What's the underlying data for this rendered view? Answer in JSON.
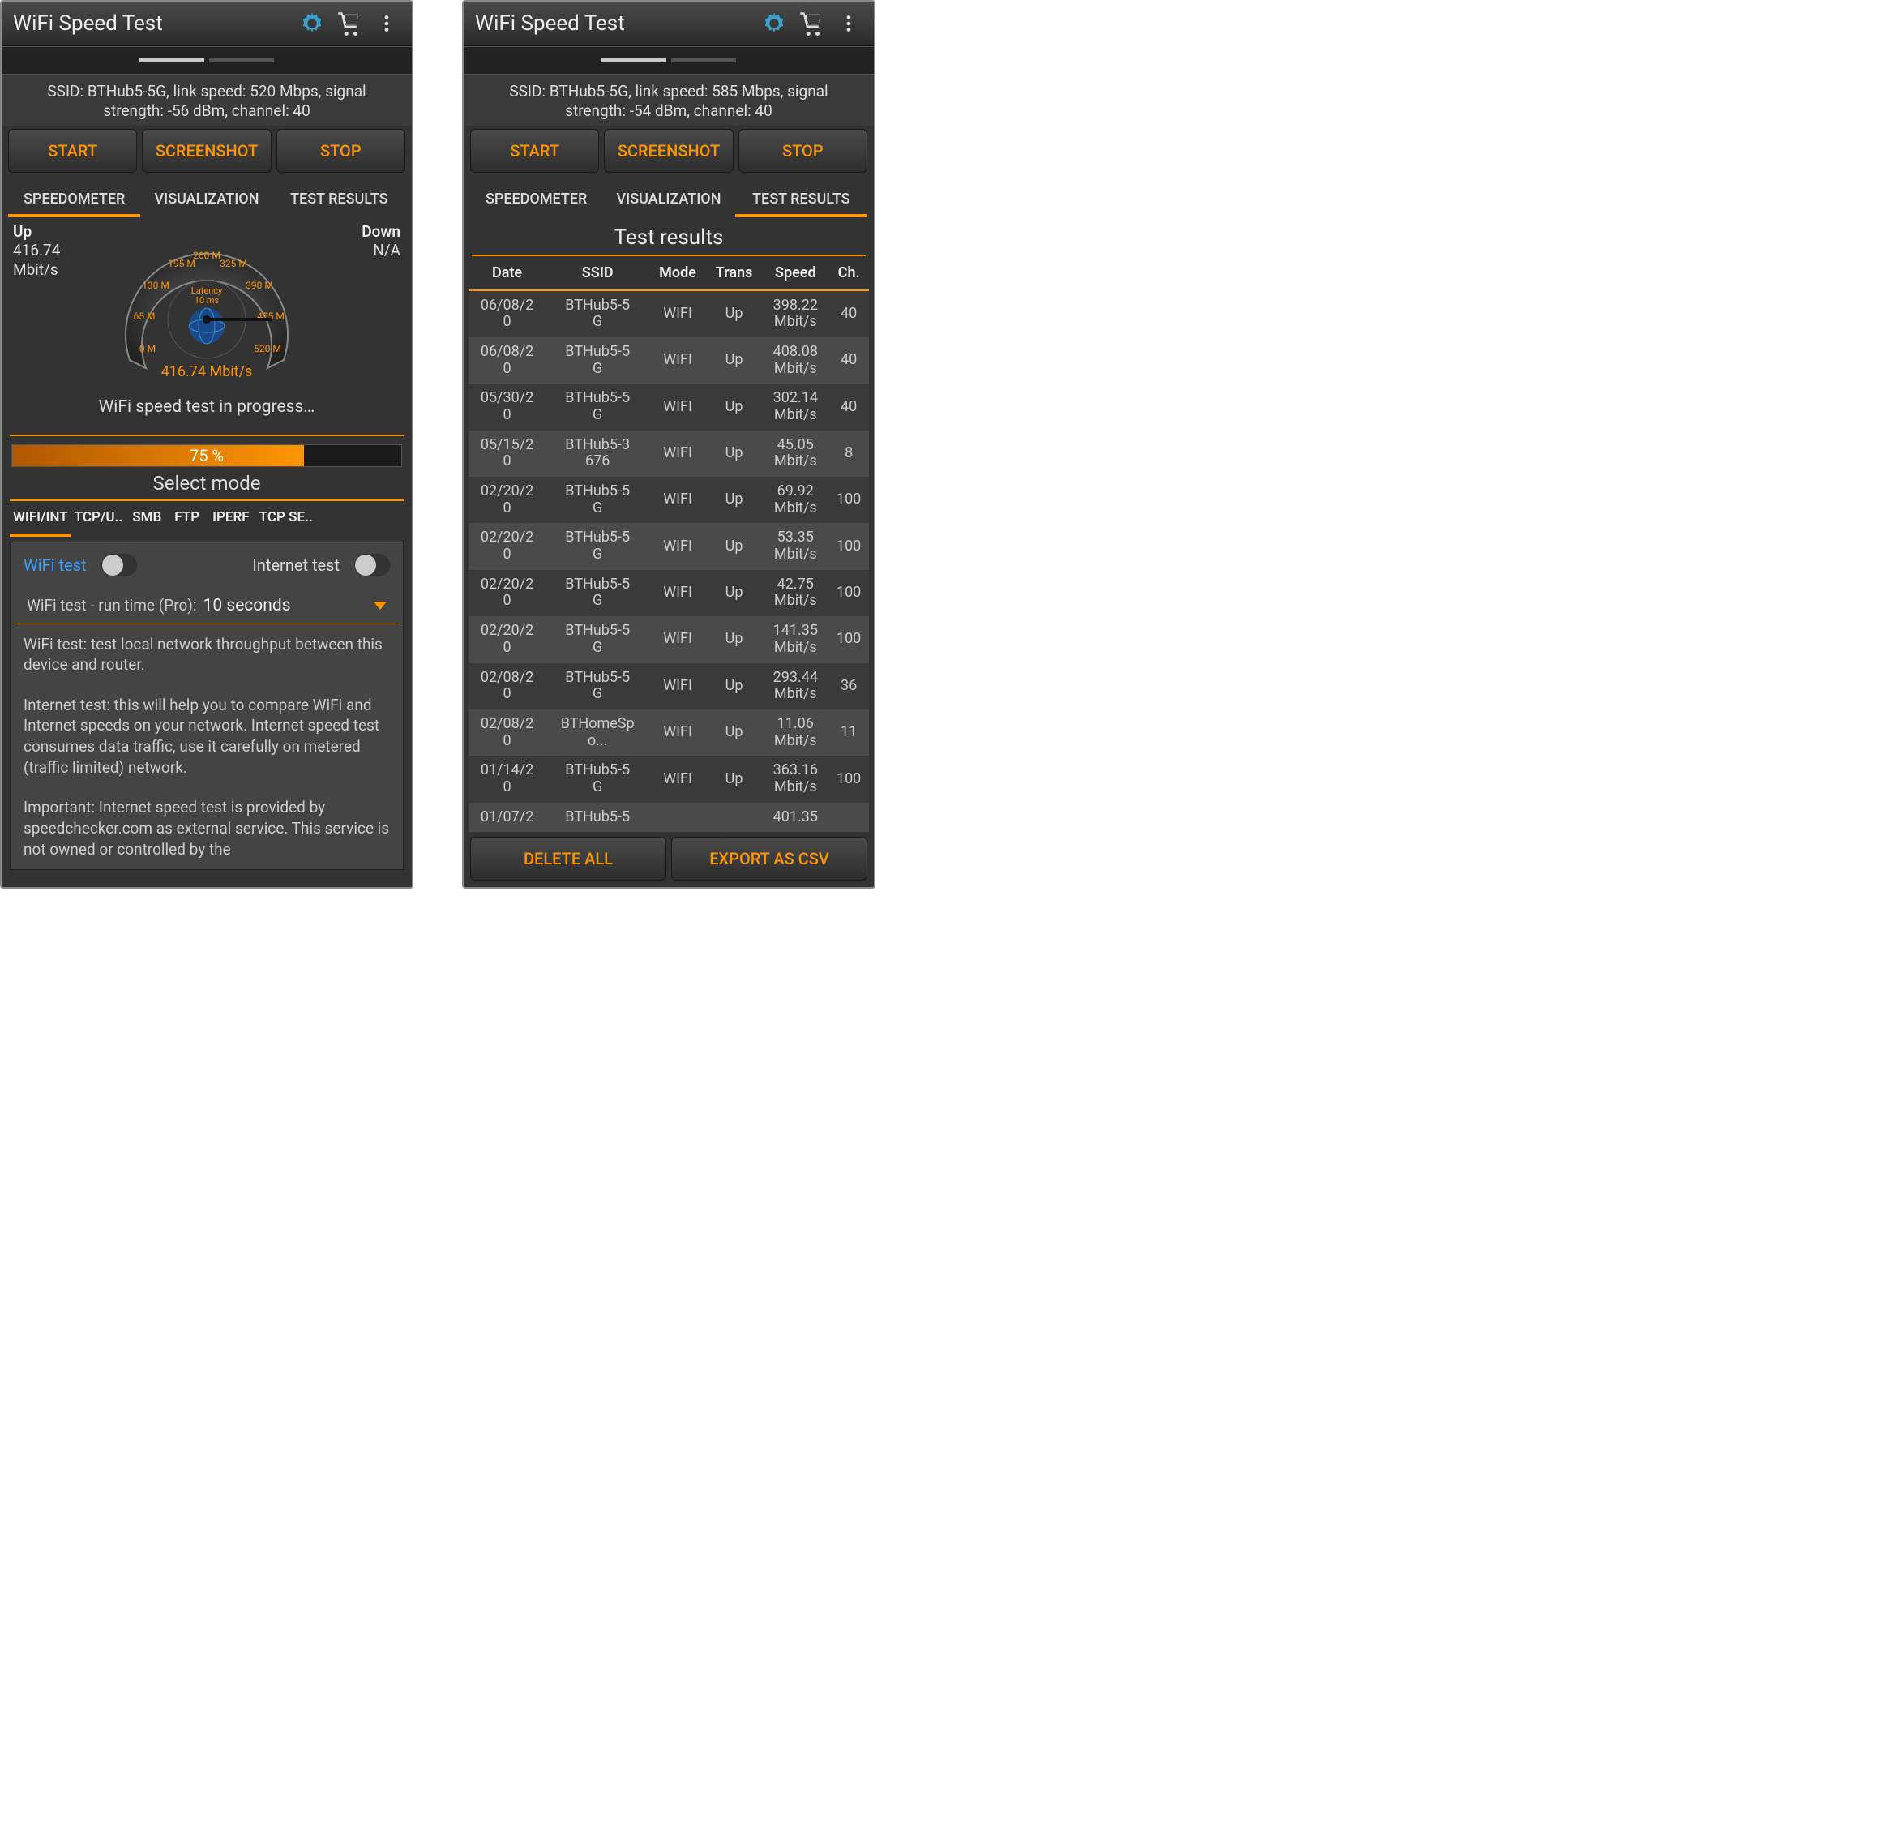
{
  "app_title": "WiFi Speed Test",
  "left": {
    "info": "SSID: BTHub5-5G, link speed: 520 Mbps, signal strength: -56 dBm, channel: 40",
    "buttons": {
      "start": "START",
      "screenshot": "SCREENSHOT",
      "stop": "STOP"
    },
    "tabs": [
      "SPEEDOMETER",
      "VISUALIZATION",
      "TEST RESULTS"
    ],
    "active_tab": 0,
    "up_label": "Up",
    "up_value": "416.74 Mbit/s",
    "down_label": "Down",
    "down_value": "N/A",
    "gauge": {
      "ticks": [
        "0 M",
        "65 M",
        "130 M",
        "195 M",
        "260 M",
        "325 M",
        "390 M",
        "455 M",
        "520 M"
      ],
      "latency_label": "Latency",
      "latency_value": "10 ms",
      "readout": "416.74 Mbit/s"
    },
    "status": "WiFi speed test in progress…",
    "progress_pct": "75 %",
    "select_mode": "Select mode",
    "mode_tabs": [
      "WIFI/INT",
      "TCP/U..",
      "SMB",
      "FTP",
      "IPERF",
      "TCP SE.."
    ],
    "active_mode": 0,
    "wifi_test_label": "WiFi test",
    "internet_test_label": "Internet test",
    "runtime_label": "WiFi test - run time (Pro):",
    "runtime_value": "10 seconds",
    "desc1": "WiFi test: test local network throughput between this device and router.",
    "desc2": " Internet test: this will help you to compare WiFi and Internet speeds on your network. Internet speed test consumes data traffic, use it carefully on metered (traffic limited) network.",
    "desc3": "Important: Internet speed test is provided by speedchecker.com as external service. This service is not owned or controlled by the"
  },
  "right": {
    "info": "SSID: BTHub5-5G, link speed: 585 Mbps, signal strength: -54 dBm, channel: 40",
    "buttons": {
      "start": "START",
      "screenshot": "SCREENSHOT",
      "stop": "STOP"
    },
    "tabs": [
      "SPEEDOMETER",
      "VISUALIZATION",
      "TEST RESULTS"
    ],
    "active_tab": 2,
    "heading": "Test results",
    "columns": [
      "Date",
      "SSID",
      "Mode",
      "Trans",
      "Speed",
      "Ch."
    ],
    "rows": [
      {
        "date": "06/08/20",
        "ssid": "BTHub5-5G",
        "mode": "WIFI",
        "trans": "Up",
        "speed": "398.22 Mbit/s",
        "ch": "40"
      },
      {
        "date": "06/08/20",
        "ssid": "BTHub5-5G",
        "mode": "WIFI",
        "trans": "Up",
        "speed": "408.08 Mbit/s",
        "ch": "40"
      },
      {
        "date": "05/30/20",
        "ssid": "BTHub5-5G",
        "mode": "WIFI",
        "trans": "Up",
        "speed": "302.14 Mbit/s",
        "ch": "40"
      },
      {
        "date": "05/15/20",
        "ssid": "BTHub5-3676",
        "mode": "WIFI",
        "trans": "Up",
        "speed": "45.05 Mbit/s",
        "ch": "8"
      },
      {
        "date": "02/20/20",
        "ssid": "BTHub5-5G",
        "mode": "WIFI",
        "trans": "Up",
        "speed": "69.92 Mbit/s",
        "ch": "100"
      },
      {
        "date": "02/20/20",
        "ssid": "BTHub5-5G",
        "mode": "WIFI",
        "trans": "Up",
        "speed": "53.35 Mbit/s",
        "ch": "100"
      },
      {
        "date": "02/20/20",
        "ssid": "BTHub5-5G",
        "mode": "WIFI",
        "trans": "Up",
        "speed": "42.75 Mbit/s",
        "ch": "100"
      },
      {
        "date": "02/20/20",
        "ssid": "BTHub5-5G",
        "mode": "WIFI",
        "trans": "Up",
        "speed": "141.35 Mbit/s",
        "ch": "100"
      },
      {
        "date": "02/08/20",
        "ssid": "BTHub5-5G",
        "mode": "WIFI",
        "trans": "Up",
        "speed": "293.44 Mbit/s",
        "ch": "36"
      },
      {
        "date": "02/08/20",
        "ssid": "BTHomeSpo...",
        "mode": "WIFI",
        "trans": "Up",
        "speed": "11.06 Mbit/s",
        "ch": "11"
      },
      {
        "date": "01/14/20",
        "ssid": "BTHub5-5G",
        "mode": "WIFI",
        "trans": "Up",
        "speed": "363.16 Mbit/s",
        "ch": "100"
      },
      {
        "date": "01/07/2",
        "ssid": "BTHub5-5",
        "mode": "",
        "trans": "",
        "speed": "401.35",
        "ch": ""
      }
    ],
    "delete_all": "DELETE ALL",
    "export_csv": "EXPORT AS CSV"
  }
}
